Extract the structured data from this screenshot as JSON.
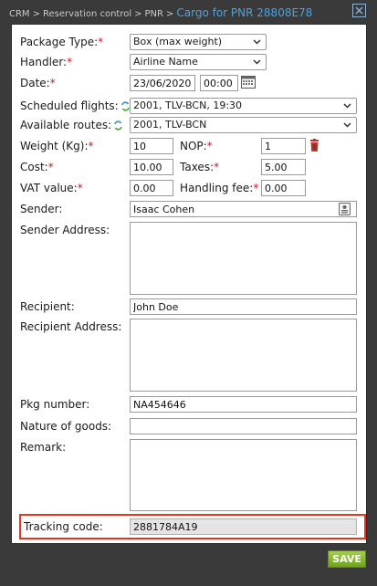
{
  "breadcrumb": {
    "items": [
      "CRM",
      "Reservation control",
      "PNR"
    ],
    "separator": ">",
    "current": "Cargo for PNR 28808E78"
  },
  "colors": {
    "accent": "#4aa3e0",
    "required": "#d0191c",
    "highlight": "#e2381f",
    "save": "#8bc234"
  },
  "form": {
    "package_type": {
      "label": "Package Type:",
      "value": "Box (max weight)",
      "required": true
    },
    "handler": {
      "label": "Handler:",
      "value": "Airline Name",
      "required": true
    },
    "date": {
      "label": "Date:",
      "value": "23/06/2020",
      "time": "00:00",
      "required": true
    },
    "scheduled_flights": {
      "label": "Scheduled flights:",
      "value": "2001, TLV-BCN, 19:30"
    },
    "available_routes": {
      "label": "Available routes:",
      "value": "2001, TLV-BCN"
    },
    "weight": {
      "label": "Weight (Kg):",
      "value": "10",
      "required": true
    },
    "nop": {
      "label": "NOP:",
      "value": "1",
      "required": true
    },
    "cost": {
      "label": "Cost:",
      "value": "10.00",
      "required": true
    },
    "taxes": {
      "label": "Taxes:",
      "value": "5.00",
      "required": true
    },
    "vat_value": {
      "label": "VAT value:",
      "value": "0.00",
      "required": true
    },
    "handling_fee": {
      "label": "Handling fee:",
      "value": "0.00",
      "required": true
    },
    "sender": {
      "label": "Sender:",
      "value": "Isaac Cohen"
    },
    "sender_address": {
      "label": "Sender Address:",
      "value": ""
    },
    "recipient": {
      "label": "Recipient:",
      "value": "John Doe"
    },
    "recipient_address": {
      "label": "Recipient Address:",
      "value": ""
    },
    "pkg_number": {
      "label": "Pkg number:",
      "value": "NA454646"
    },
    "nature_of_goods": {
      "label": "Nature of goods:",
      "value": ""
    },
    "remark": {
      "label": "Remark:",
      "value": ""
    },
    "tracking_code": {
      "label": "Tracking code:",
      "value": "2881784A19"
    },
    "required_mark": "*"
  },
  "footer": {
    "save_label": "SAVE"
  }
}
